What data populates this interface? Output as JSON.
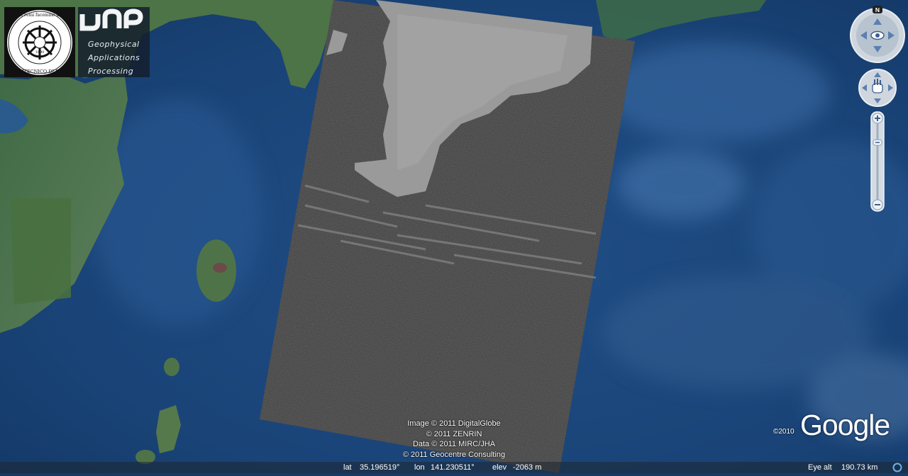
{
  "map": {
    "credits": [
      "Image © 2011 DigitalGlobe",
      "© 2011 ZENRIN",
      "Data © 2011 MIRC/JHA",
      "© 2011 Geocentre Consulting"
    ],
    "google_copyright": "©2010",
    "google_logo": "Google"
  },
  "logos": {
    "poliba_arc_text": "de remi facemmo ali",
    "poliba_bottom_text": "POLITECNICO DI BARI",
    "poliba_center_mark": "1990",
    "gap_lines": [
      "Geophysical",
      "Applications",
      "Processing"
    ]
  },
  "navigation": {
    "north_label": "N",
    "compass_icon": "eye-icon",
    "pan_icon": "hand-icon",
    "zoom_in_icon": "plus-icon",
    "zoom_out_icon": "minus-icon",
    "zoom_level": 0.2
  },
  "statusbar": {
    "lat_label": "lat",
    "lat_value": "35.196519°",
    "lon_label": "lon",
    "lon_value": "141.230511°",
    "elev_label": "elev",
    "elev_value": "-2063 m",
    "eye_alt_label": "Eye alt",
    "eye_alt_value": "190.73 km"
  }
}
